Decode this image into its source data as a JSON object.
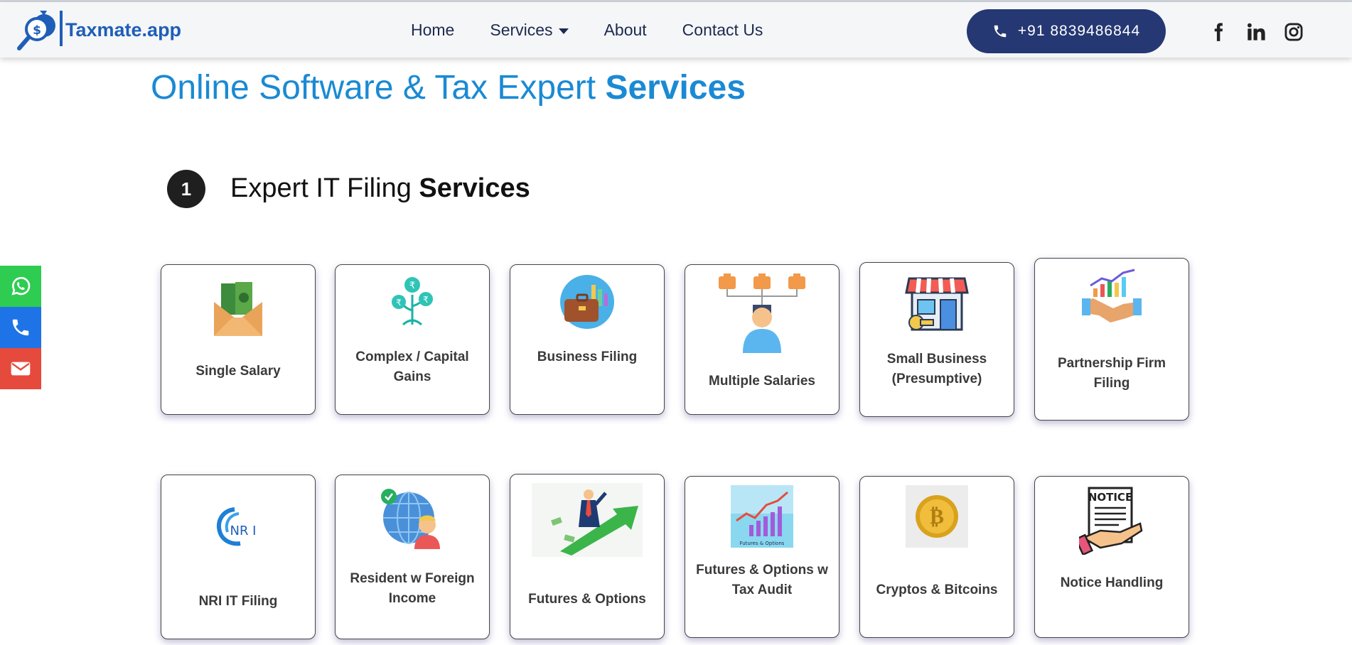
{
  "brand": {
    "name": "Taxmate.app"
  },
  "nav": {
    "home": "Home",
    "services": "Services",
    "about": "About",
    "contact": "Contact Us"
  },
  "phone": {
    "label": "+91 8839486844"
  },
  "social": [
    "facebook-icon",
    "linkedin-icon",
    "instagram-icon"
  ],
  "page": {
    "title_light": "Online Software & Tax Expert",
    "title_bold": "Services"
  },
  "section1": {
    "number": "1",
    "title_light": "Expert IT Filing",
    "title_bold": "Services"
  },
  "services_row1": [
    {
      "label": "Single Salary",
      "icon": "salary-envelope-icon"
    },
    {
      "label": "Complex / Capital Gains",
      "icon": "rupee-plant-icon"
    },
    {
      "label": "Business Filing",
      "icon": "briefcase-chart-icon"
    },
    {
      "label": "Multiple Salaries",
      "icon": "person-briefcases-icon"
    },
    {
      "label": "Small Business (Presumptive)",
      "icon": "shop-icon"
    },
    {
      "label": "Partnership Firm Filing",
      "icon": "handshake-icon"
    }
  ],
  "services_row2": [
    {
      "label": "NRI IT Filing",
      "icon": "nri-logo-icon",
      "icon_text": "NR I"
    },
    {
      "label": "Resident w Foreign Income",
      "icon": "globe-person-icon"
    },
    {
      "label": "Futures & Options",
      "icon": "businessman-arrow-icon"
    },
    {
      "label": "Futures & Options w Tax Audit",
      "icon": "futures-options-chart-icon",
      "icon_text": "Futures & Options"
    },
    {
      "label": "Cryptos & Bitcoins",
      "icon": "bitcoin-icon"
    },
    {
      "label": "Notice Handling",
      "icon": "notice-hand-icon",
      "icon_text": "NOTICE"
    }
  ],
  "colors": {
    "brand_blue": "#1f5eb8",
    "title_blue": "#1a8ad4",
    "nav_dark": "#253873",
    "whatsapp": "#2ecc51",
    "call": "#1e74e6",
    "mail": "#e64a3c"
  }
}
